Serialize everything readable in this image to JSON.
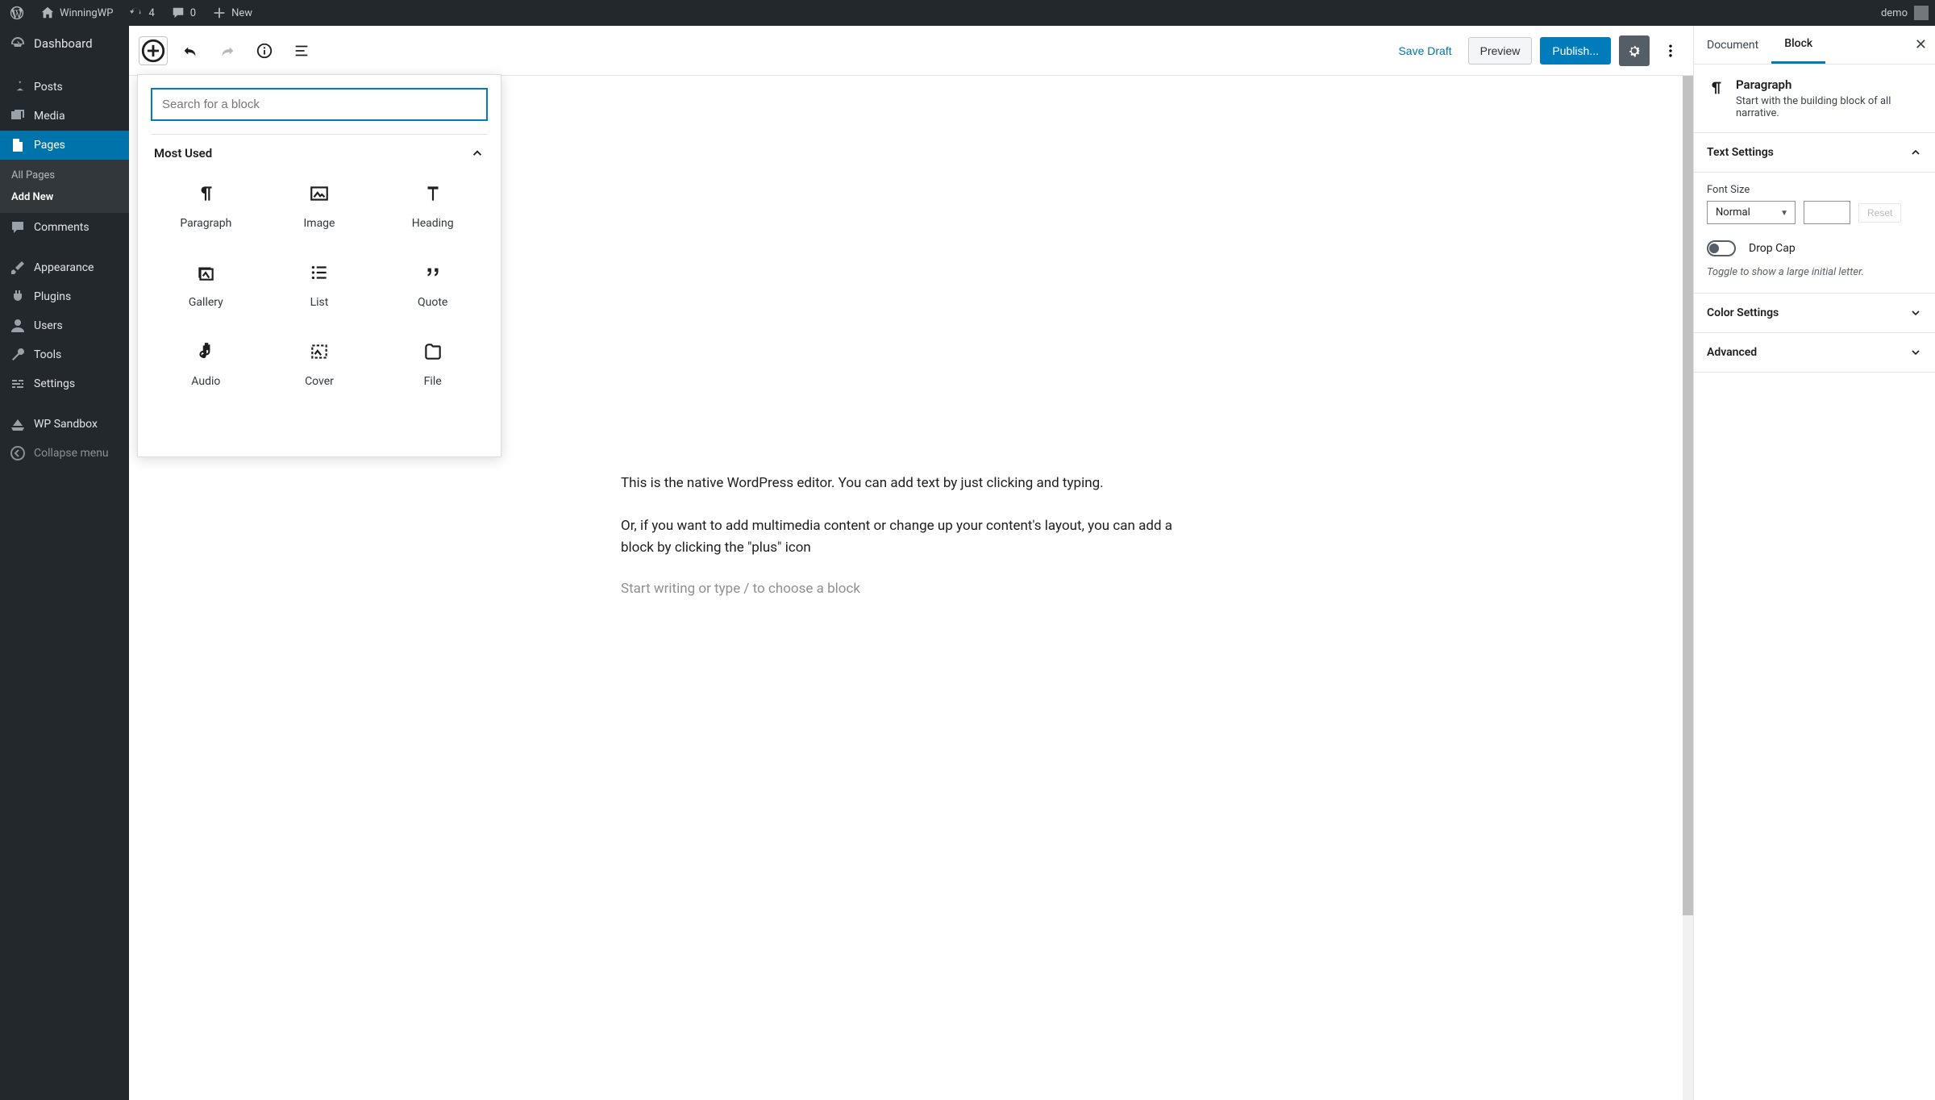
{
  "adminbar": {
    "site_name": "WinningWP",
    "updates_count": "4",
    "comments_count": "0",
    "new_label": "New",
    "user_name": "demo"
  },
  "sidebar": {
    "dashboard": "Dashboard",
    "posts": "Posts",
    "media": "Media",
    "pages": "Pages",
    "pages_sub_all": "All Pages",
    "pages_sub_add": "Add New",
    "comments": "Comments",
    "appearance": "Appearance",
    "plugins": "Plugins",
    "users": "Users",
    "tools": "Tools",
    "settings": "Settings",
    "sandbox": "WP Sandbox",
    "collapse": "Collapse menu"
  },
  "header": {
    "save_draft": "Save Draft",
    "preview": "Preview",
    "publish": "Publish..."
  },
  "inserter": {
    "search_placeholder": "Search for a block",
    "category": "Most Used",
    "blocks": {
      "paragraph": "Paragraph",
      "image": "Image",
      "heading": "Heading",
      "gallery": "Gallery",
      "list": "List",
      "quote": "Quote",
      "audio": "Audio",
      "cover": "Cover",
      "file": "File"
    }
  },
  "content": {
    "p1": "This is the native WordPress editor. You can add text by just clicking and typing.",
    "p2": "Or, if you want to add multimedia content or change up your content's layout, you can add a block by clicking the \"plus\" icon",
    "placeholder": "Start writing or type / to choose a block"
  },
  "settings": {
    "tab_document": "Document",
    "tab_block": "Block",
    "block_name": "Paragraph",
    "block_desc": "Start with the building block of all narrative.",
    "text_settings_title": "Text Settings",
    "font_size_label": "Font Size",
    "font_size_value": "Normal",
    "reset_label": "Reset",
    "drop_cap_label": "Drop Cap",
    "drop_cap_help": "Toggle to show a large initial letter.",
    "color_settings_title": "Color Settings",
    "advanced_title": "Advanced"
  }
}
